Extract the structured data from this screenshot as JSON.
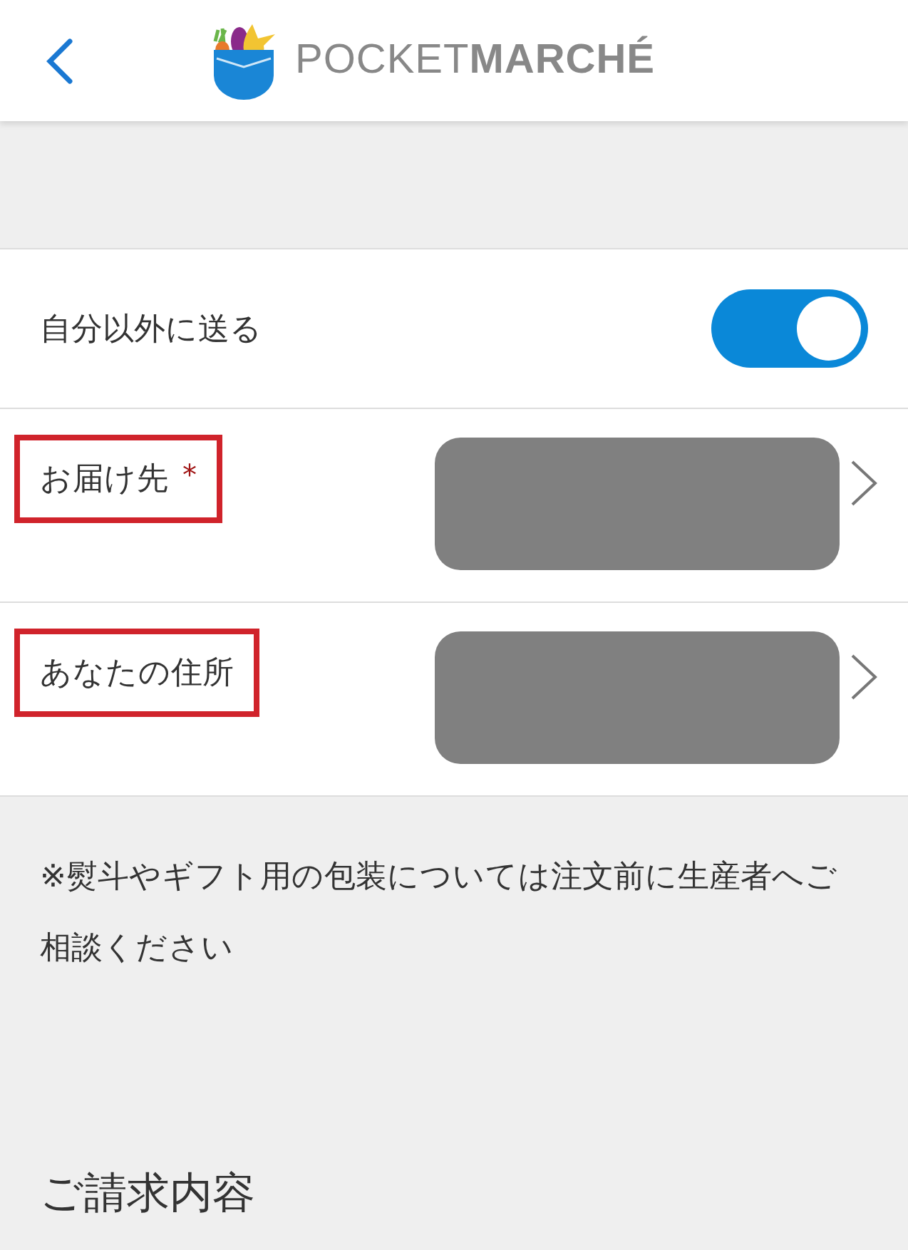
{
  "header": {
    "logo_text": "POCKET**MARCHÉ**"
  },
  "settings": [
    {
      "kind": "toggle",
      "label": "自分以外に送る",
      "on": true
    },
    {
      "kind": "link",
      "label": "お届け先",
      "required_mark": "*",
      "highlighted": true,
      "value_redacted": true
    },
    {
      "kind": "link",
      "label": "あなたの住所",
      "highlighted": true,
      "value_redacted": true
    }
  ],
  "note": "※熨斗やギフト用の包装については注文前に生産者へご相談ください",
  "section_heading": "ご請求内容"
}
